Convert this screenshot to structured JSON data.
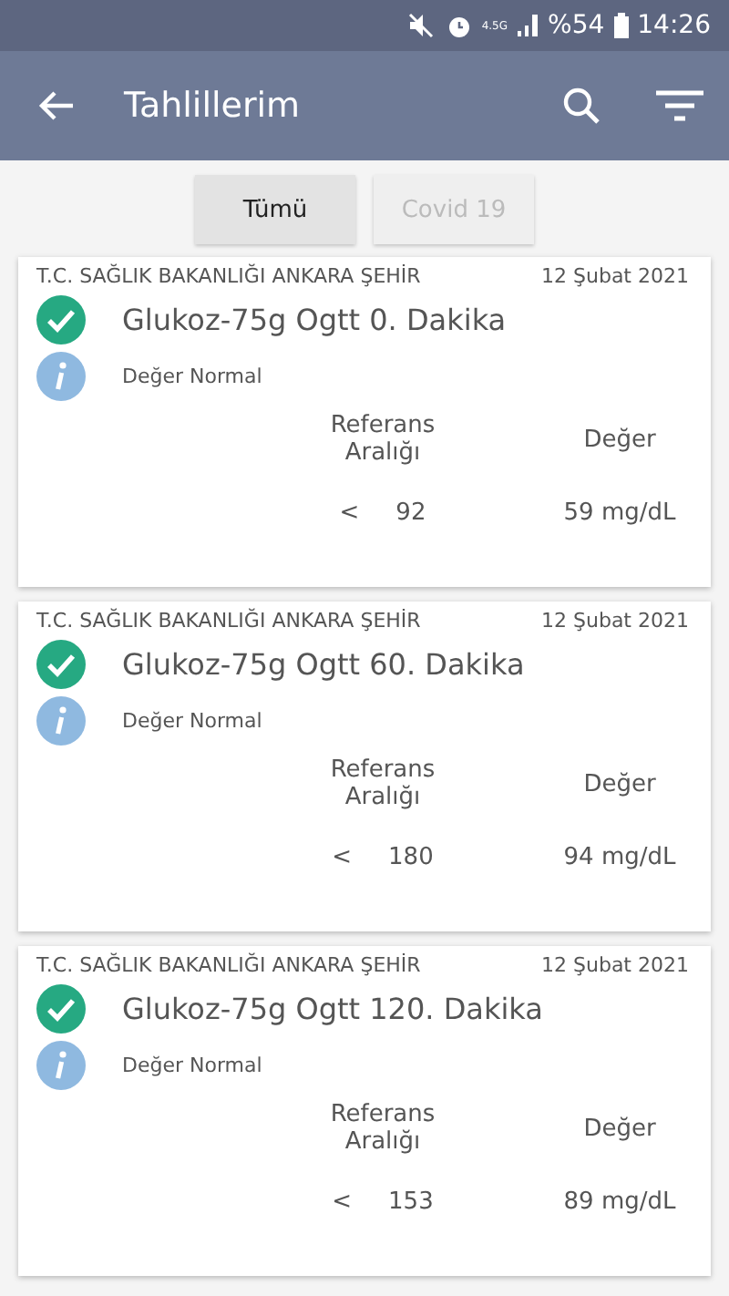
{
  "status_bar": {
    "network": "4.5G",
    "battery": "%54",
    "time": "14:26"
  },
  "app_bar": {
    "title": "Tahlillerim"
  },
  "filters": [
    {
      "label": "Tümü",
      "selected": true
    },
    {
      "label": "Covid 19",
      "selected": false
    }
  ],
  "results": [
    {
      "source": "T.C. SAĞLIK BAKANLIĞI ANKARA ŞEHİR",
      "date": "12 Şubat 2021",
      "title": "Glukoz-75g Ogtt 0. Dakika",
      "normal": true,
      "note": "Değer Normal",
      "reference_header": "Referans Aralığı",
      "value_header": "Değer",
      "comparator": "<",
      "reference": "92",
      "value": "59 mg/dL"
    },
    {
      "source": "T.C. SAĞLIK BAKANLIĞI ANKARA ŞEHİR",
      "date": "12 Şubat 2021",
      "title": "Glukoz-75g Ogtt 60. Dakika",
      "normal": true,
      "note": "Değer Normal",
      "reference_header": "Referans Aralığı",
      "value_header": "Değer",
      "comparator": "<",
      "reference": "180",
      "value": "94 mg/dL"
    },
    {
      "source": "T.C. SAĞLIK BAKANLIĞI ANKARA ŞEHİR",
      "date": "12 Şubat 2021",
      "title": "Glukoz-75g Ogtt 120. Dakika",
      "normal": true,
      "note": "Değer Normal",
      "reference_header": "Referans Aralığı",
      "value_header": "Değer",
      "comparator": "<",
      "reference": "153",
      "value": "89 mg/dL"
    }
  ]
}
